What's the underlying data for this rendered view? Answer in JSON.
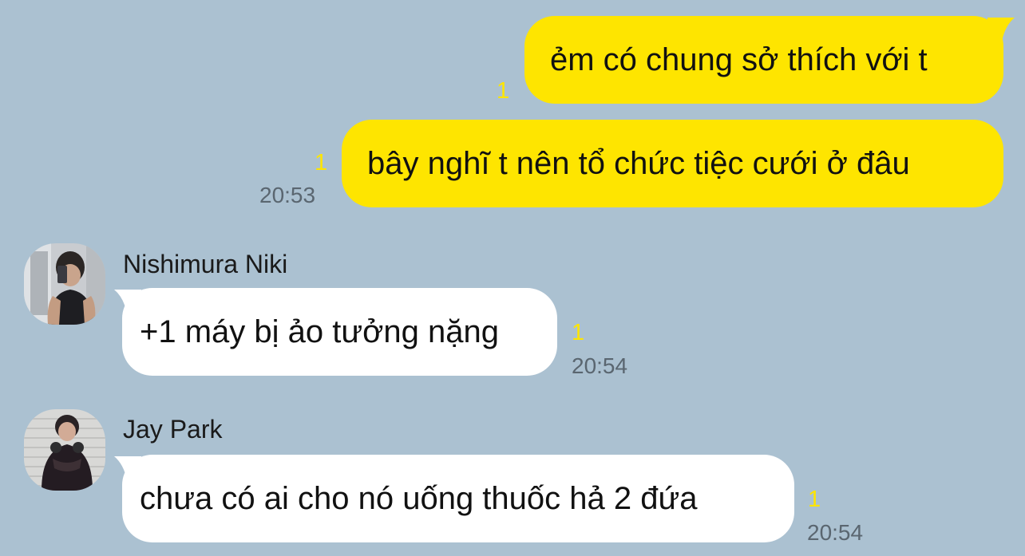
{
  "colors": {
    "background": "#abc1d1",
    "my_bubble": "#fee500",
    "their_bubble": "#ffffff",
    "unread_count": "#fee500",
    "timestamp": "#5a6670"
  },
  "chat": {
    "messages": [
      {
        "from": "me",
        "text": "ẻm có chung sở thích với t",
        "unread": "1",
        "time": ""
      },
      {
        "from": "me",
        "text": "bây nghĩ t nên tổ chức tiệc cưới ở đâu",
        "unread": "1",
        "time": "20:53"
      },
      {
        "from": "Nishimura Niki",
        "avatar_icon": "profile-photo",
        "text": "+1 máy bị ảo tưởng nặng",
        "unread": "1",
        "time": "20:54"
      },
      {
        "from": "Jay Park",
        "avatar_icon": "profile-photo",
        "text": "chưa có ai cho nó uống thuốc hả 2 đứa",
        "unread": "1",
        "time": "20:54"
      }
    ]
  }
}
